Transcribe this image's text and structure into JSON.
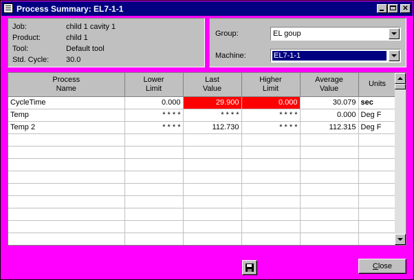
{
  "window": {
    "title": "Process Summary:  EL7-1-1"
  },
  "info": [
    {
      "label": "Job:",
      "value": "child 1 cavity 1"
    },
    {
      "label": "Product:",
      "value": "child 1"
    },
    {
      "label": "Tool:",
      "value": "Default tool"
    },
    {
      "label": "Std. Cycle:",
      "value": "30.0"
    }
  ],
  "filters": {
    "group_label": "Group:",
    "group_value": "EL goup",
    "machine_label": "Machine:",
    "machine_value": "EL7-1-1"
  },
  "table": {
    "headers": [
      [
        "Process",
        "Name"
      ],
      [
        "Lower",
        "Limit"
      ],
      [
        "Last",
        "Value"
      ],
      [
        "Higher",
        "Limit"
      ],
      [
        "Average",
        "Value"
      ],
      [
        "Units",
        ""
      ]
    ],
    "rows": [
      {
        "name": "CycleTime",
        "lower": "0.000",
        "last": "29.900",
        "higher": "0.000",
        "avg": "30.079",
        "units": "sec"
      },
      {
        "name": "Temp",
        "lower": "* * * *",
        "last": "* * * *",
        "higher": "* * * *",
        "avg": "0.000",
        "units": "Deg F"
      },
      {
        "name": "Temp 2",
        "lower": "* * * *",
        "last": "112.730",
        "higher": "* * * *",
        "avg": "112.315",
        "units": "Deg F"
      }
    ],
    "alarm_color": "#ff0000"
  },
  "footer": {
    "close_label": "Close",
    "save_icon": "floppy-disk-icon"
  },
  "colors": {
    "background": "#ff00ff",
    "titlebar": "#000080",
    "panel": "#c0c0c0"
  }
}
